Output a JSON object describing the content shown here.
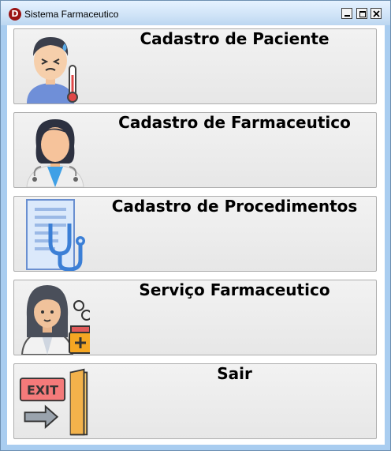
{
  "window": {
    "title": "Sistema Farmaceutico",
    "app_icon_letter": "D"
  },
  "buttons": [
    {
      "label": "Cadastro de Paciente",
      "icon": "sick-patient-thermometer-icon"
    },
    {
      "label": "Cadastro de Farmaceutico",
      "icon": "pharmacist-doctor-icon"
    },
    {
      "label": "Cadastro de Procedimentos",
      "icon": "clipboard-stethoscope-icon"
    },
    {
      "label": "Serviço Farmaceutico",
      "icon": "pharmacist-medicine-icon"
    },
    {
      "label": "Sair",
      "icon": "exit-door-icon"
    }
  ],
  "colors": {
    "window_frame": "#a9cdf0",
    "button_face": "#ededed",
    "exit_sign": "#f47a7a"
  }
}
